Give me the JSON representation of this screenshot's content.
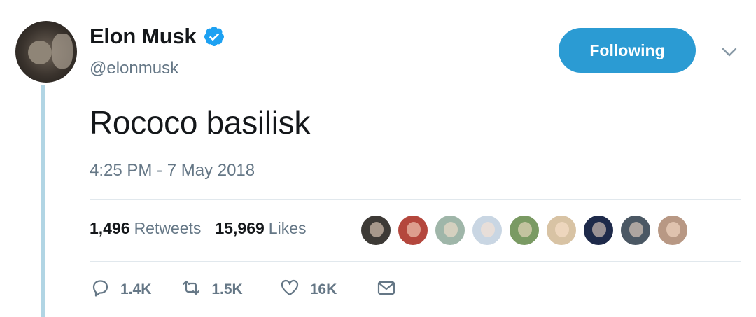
{
  "author": {
    "display_name": "Elon Musk",
    "handle": "@elonmusk",
    "verified": true
  },
  "follow_button_label": "Following",
  "tweet": {
    "text": "Rococo basilisk",
    "timestamp": "4:25 PM - 7 May 2018"
  },
  "stats": {
    "retweets_count": "1,496",
    "retweets_label": "Retweets",
    "likes_count": "15,969",
    "likes_label": "Likes"
  },
  "likers": [
    {
      "color": "#3d3a36"
    },
    {
      "color": "#b4473d"
    },
    {
      "color": "#9fb6a9"
    },
    {
      "color": "#c9d6e3"
    },
    {
      "color": "#7a9a63"
    },
    {
      "color": "#d8c3a4"
    },
    {
      "color": "#1e2a4a"
    },
    {
      "color": "#4b5864"
    },
    {
      "color": "#b89884"
    }
  ],
  "actions": {
    "reply_count": "1.4K",
    "retweet_count": "1.5K",
    "like_count": "16K"
  },
  "colors": {
    "accent": "#2b9bd3",
    "thread_line": "#b1d5e4",
    "muted_text": "#657786",
    "verified_badge": "#1da1f2"
  },
  "icons": {
    "verified": "verified-badge-icon",
    "chevron": "chevron-down-icon",
    "reply": "reply-icon",
    "retweet": "retweet-icon",
    "like": "heart-icon",
    "dm": "envelope-icon"
  }
}
